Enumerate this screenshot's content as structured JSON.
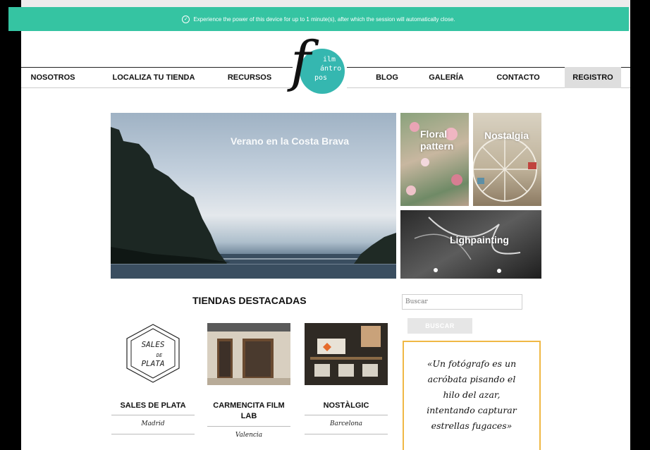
{
  "banner": {
    "message": "Experience the power of this device for up to 1 minute(s), after which the session will automatically close."
  },
  "nav": {
    "items": [
      "NOSOTROS",
      "LOCALIZA TU TIENDA",
      "RECURSOS",
      "BLOG",
      "GALERÍA",
      "CONTACTO",
      "REGISTRO"
    ]
  },
  "logo": {
    "line1": "ilm",
    "line2": "ántro",
    "line3": "pos"
  },
  "hero": {
    "title": "Verano en la Costa Brava"
  },
  "tiles": [
    {
      "title": "Floral pattern"
    },
    {
      "title": "Nostalgia"
    },
    {
      "title": "Lighpainting"
    }
  ],
  "featured": {
    "title": "TIENDAS DESTACADAS",
    "stores": [
      {
        "name": "SALES DE PLATA",
        "city": "Madrid",
        "logo_text": [
          "SALES",
          "DE",
          "PLATA"
        ]
      },
      {
        "name": "CARMENCITA FILM LAB",
        "city": "Valencia"
      },
      {
        "name": "NOSTÀLGIC",
        "city": "Barcelona"
      }
    ]
  },
  "sidebar": {
    "search_placeholder": "Buscar",
    "search_button": "BUSCAR",
    "quote": "«Un fotógrafo es un\nacróbata pisando el\nhilo del azar,\nintentando capturar\nestrellas fugaces»"
  },
  "colors": {
    "banner": "#35c4a2",
    "logo": "#35b7b0",
    "quote_border": "#f0b845"
  }
}
